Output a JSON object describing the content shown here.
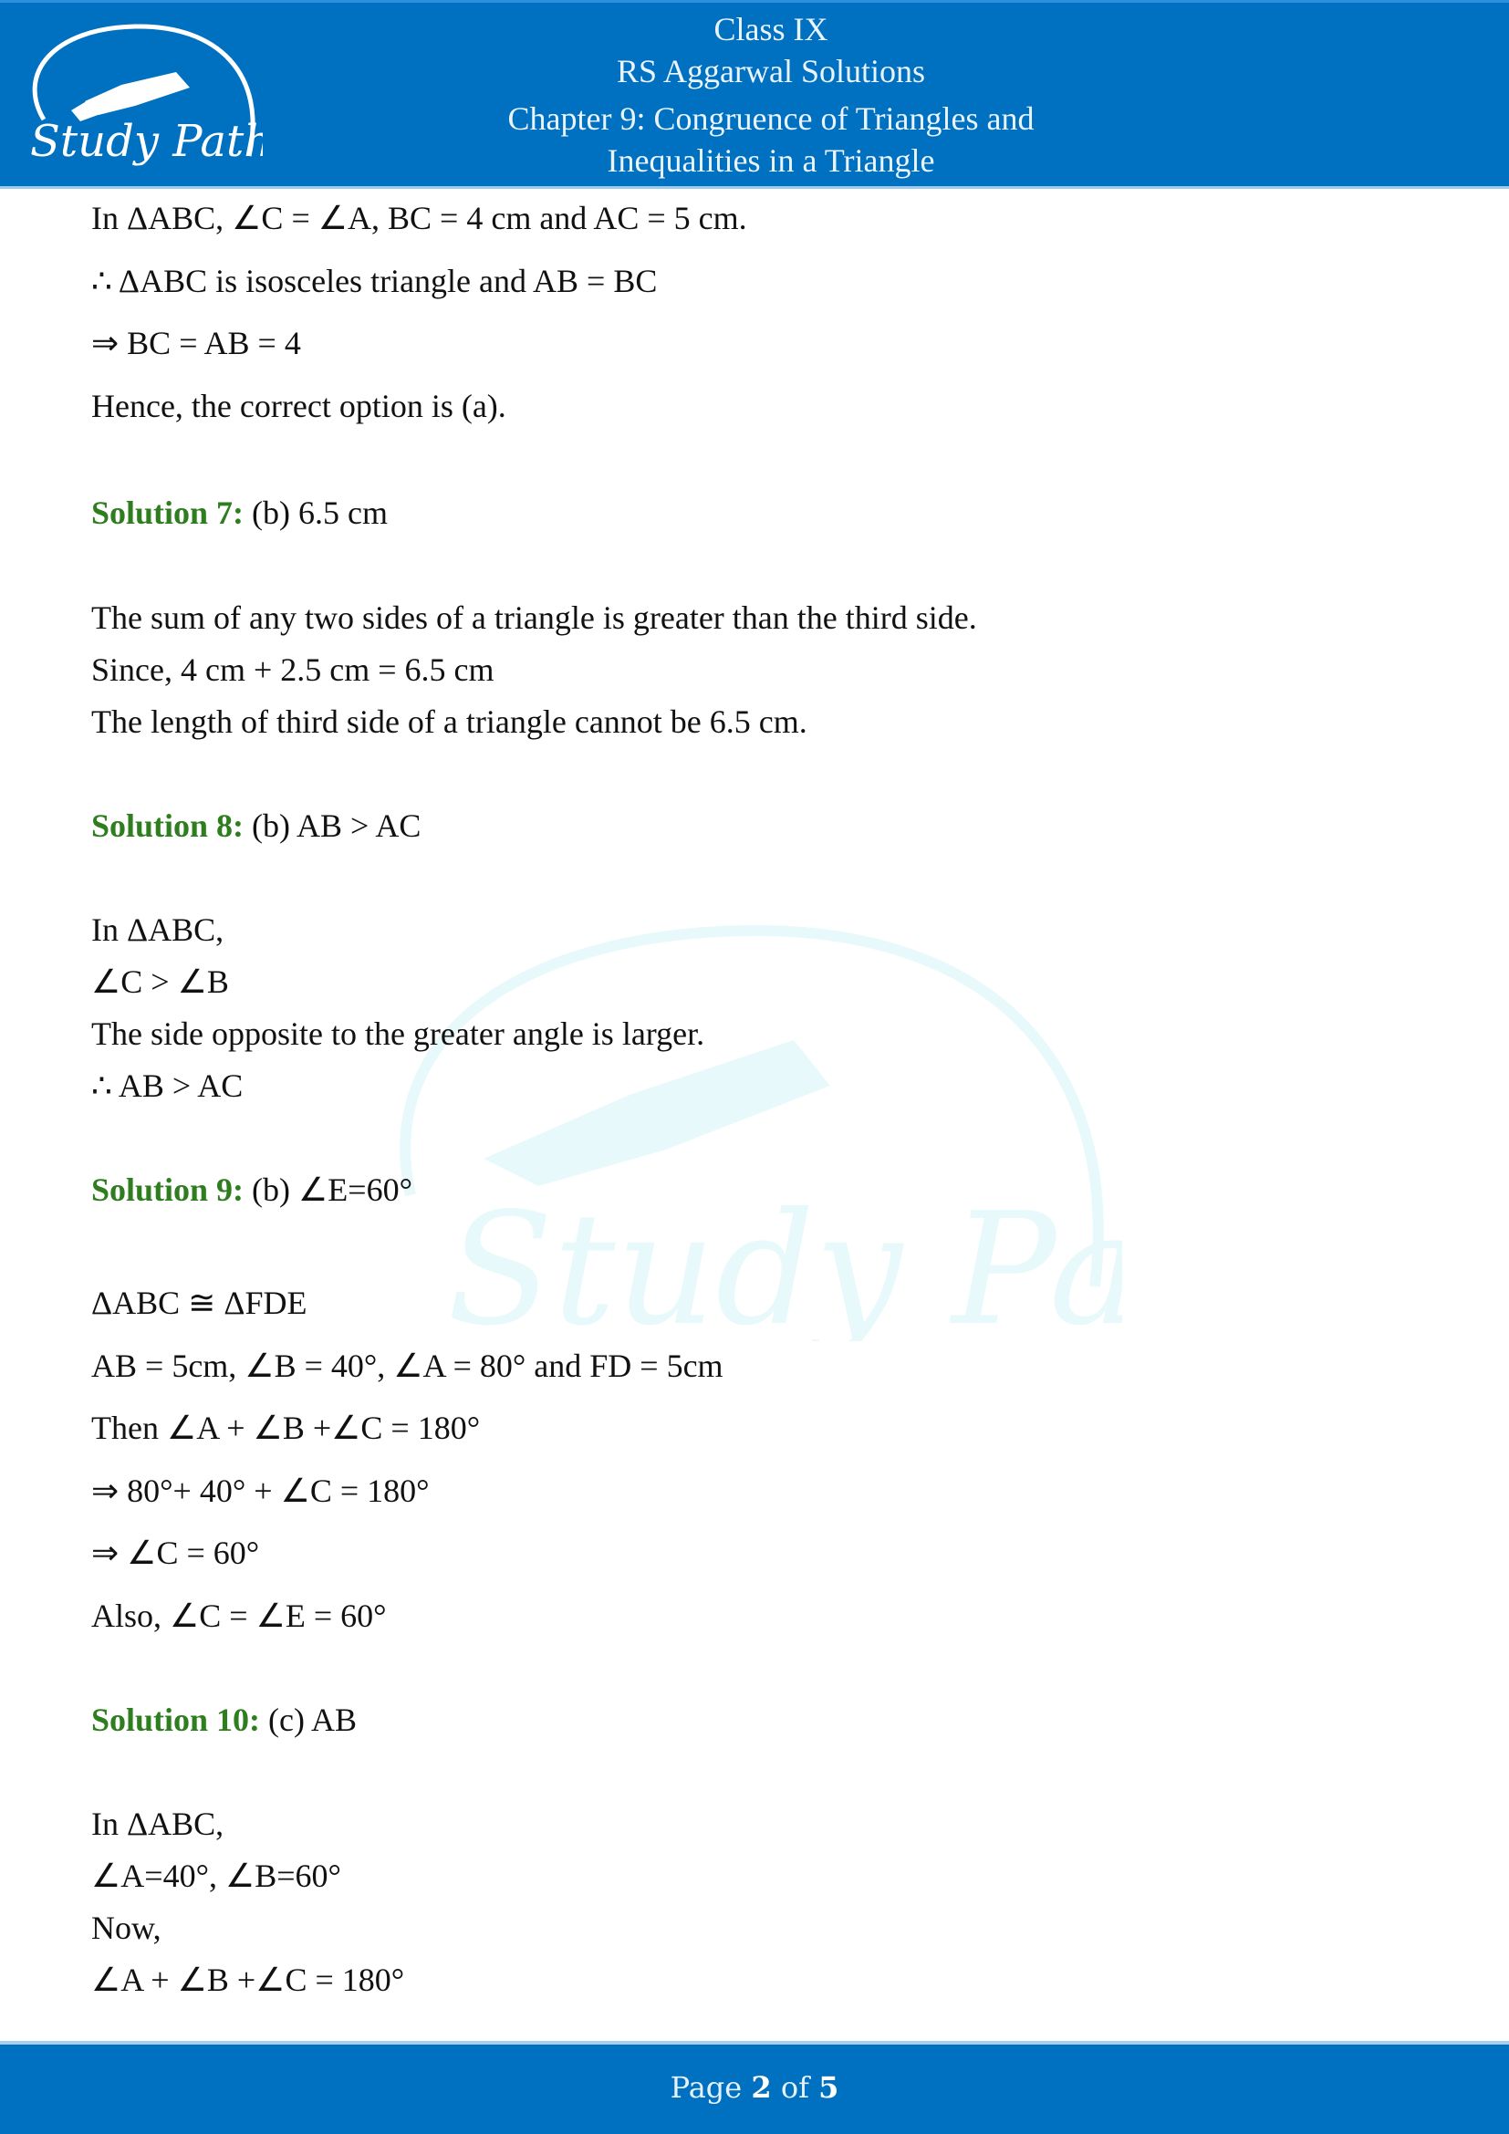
{
  "header": {
    "logo_text": "Study Path",
    "class": "Class IX",
    "book": "RS Aggarwal Solutions",
    "chapter_line1": "Chapter 9: Congruence of Triangles and",
    "chapter_line2": "Inequalities in a Triangle"
  },
  "watermark_text": "Study Path",
  "content": {
    "intro": [
      "In ΔABC, ∠C = ∠A, BC = 4 cm and AC = 5 cm.",
      "∴ ΔABC is isosceles triangle and AB = BC",
      "⇒ BC = AB = 4",
      "Hence, the correct option is (a)."
    ],
    "solutions": [
      {
        "label": "Solution 7:",
        "answer": " (b) 6.5 cm",
        "lines": [
          "The sum of any two sides of a triangle is greater than the third side.",
          "Since, 4 cm + 2.5 cm = 6.5 cm",
          "The length of third side of a triangle cannot be 6.5 cm."
        ]
      },
      {
        "label": "Solution 8:",
        "answer": " (b) AB > AC",
        "lines": [
          "In ΔABC,",
          " ∠C > ∠B",
          "The side opposite to the greater angle is larger.",
          "∴ AB > AC"
        ]
      },
      {
        "label": "Solution 9:",
        "answer": " (b) ∠E=60°",
        "lines": [
          "ΔABC ≅ ΔFDE",
          "AB = 5cm, ∠B = 40°, ∠A = 80° and FD = 5cm",
          "Then ∠A + ∠B +∠C = 180°",
          "⇒ 80°+ 40° + ∠C = 180°",
          "⇒ ∠C = 60°",
          "Also, ∠C = ∠E = 60°"
        ]
      },
      {
        "label": "Solution 10:",
        "answer": " (c) AB",
        "lines": [
          "In  ΔABC,",
          "∠A=40°, ∠B=60°",
          "Now,",
          "∠A + ∠B +∠C = 180°"
        ]
      }
    ]
  },
  "footer": {
    "prefix": "Page ",
    "current": "2",
    "middle": " of ",
    "total": "5"
  },
  "colors": {
    "header_bg": "#0070c0",
    "solution_label": "#2e7d1e",
    "watermark": "#4dd0e1"
  }
}
